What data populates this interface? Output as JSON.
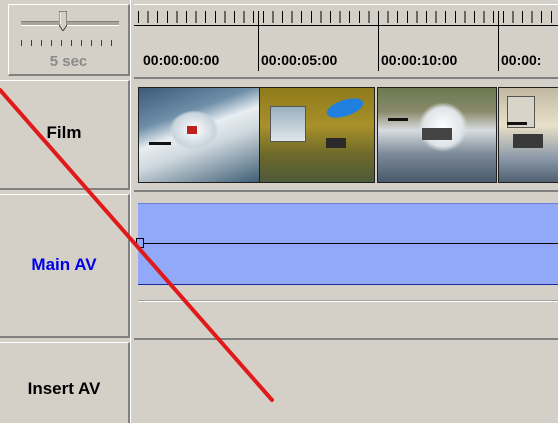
{
  "zoom": {
    "label": "5 sec"
  },
  "ruler": {
    "timecodes": [
      "00:00:00:00",
      "00:00:05:00",
      "00:00:10:00",
      "00:00:"
    ]
  },
  "tracks": {
    "film": "Film",
    "main_av": "Main AV",
    "insert_av": "Insert AV"
  },
  "film_strip": {
    "frames": [
      "jet-ski-splash",
      "green-water-jump",
      "speedboat-splash",
      "boat-driver"
    ]
  },
  "colors": {
    "audio_clip": "#92a8f8",
    "main_av_label": "#0000e8",
    "annotation_line": "#e01a1a",
    "panel_bg": "#d4d0c8"
  }
}
